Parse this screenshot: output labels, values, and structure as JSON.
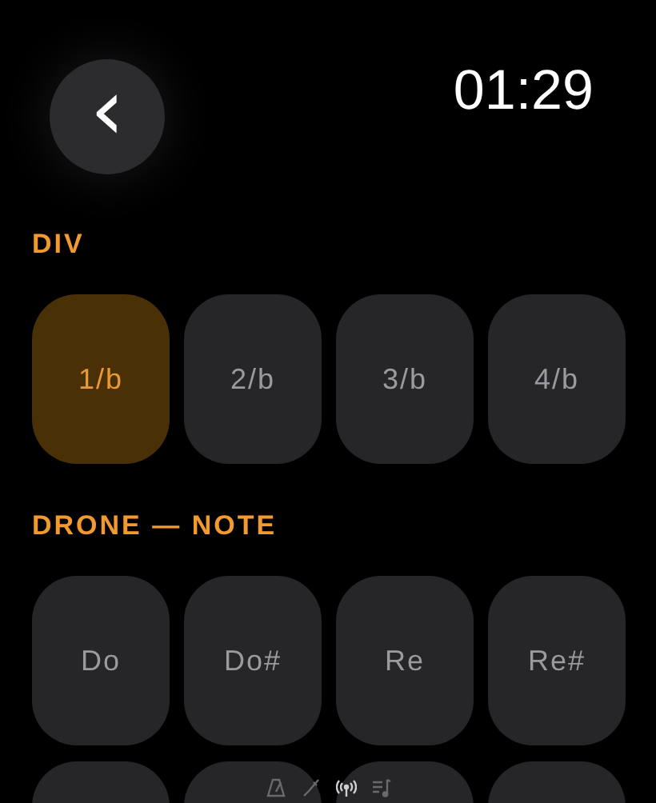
{
  "header": {
    "back": "‹",
    "time": "01:29"
  },
  "sections": [
    {
      "title": "DIV",
      "options": [
        {
          "label": "1/b",
          "selected": true
        },
        {
          "label": "2/b",
          "selected": false
        },
        {
          "label": "3/b",
          "selected": false
        },
        {
          "label": "4/b",
          "selected": false
        }
      ]
    },
    {
      "title": "DRONE — NOTE",
      "options": [
        {
          "label": "Do",
          "selected": false
        },
        {
          "label": "Do#",
          "selected": false
        },
        {
          "label": "Re",
          "selected": false
        },
        {
          "label": "Re#",
          "selected": false
        },
        {
          "selected": false
        },
        {
          "selected": false
        },
        {
          "selected": false
        },
        {
          "selected": false
        }
      ]
    }
  ],
  "pages": [
    {
      "kind": "metronome",
      "selected": false
    },
    {
      "kind": "tuner",
      "selected": false
    },
    {
      "kind": "drone",
      "selected": true
    },
    {
      "kind": "playlist",
      "selected": false
    }
  ]
}
